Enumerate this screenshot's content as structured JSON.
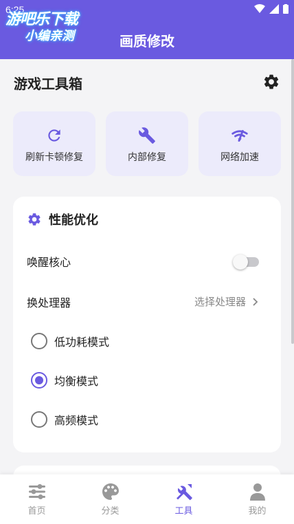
{
  "status_bar": {
    "time": "6:25"
  },
  "watermark": {
    "line1": "游吧乐下载",
    "line2": "小编亲测"
  },
  "header": {
    "title": "画质修改"
  },
  "toolbox": {
    "title": "游戏工具箱",
    "settings_icon": "gear-icon"
  },
  "tools": [
    {
      "label": "刷新卡顿修复",
      "icon": "refresh-icon"
    },
    {
      "label": "内部修复",
      "icon": "wrench-icon"
    },
    {
      "label": "网络加速",
      "icon": "wifi-signal-icon"
    }
  ],
  "performance": {
    "title": "性能优化",
    "wake_core": {
      "label": "唤醒核心",
      "enabled": false
    },
    "processor": {
      "label": "换处理器",
      "value": "选择处理器"
    },
    "modes": [
      {
        "label": "低功耗模式",
        "selected": false
      },
      {
        "label": "均衡模式",
        "selected": true
      },
      {
        "label": "高频模式",
        "selected": false
      }
    ]
  },
  "bottom_nav": [
    {
      "label": "首页",
      "icon": "sliders-icon",
      "active": false
    },
    {
      "label": "分类",
      "icon": "palette-icon",
      "active": false
    },
    {
      "label": "工具",
      "icon": "tools-icon",
      "active": true
    },
    {
      "label": "我的",
      "icon": "user-icon",
      "active": false
    }
  ],
  "colors": {
    "accent": "#6a5ae0",
    "card_tint": "#ecebfb",
    "background": "#f4f4f6"
  }
}
